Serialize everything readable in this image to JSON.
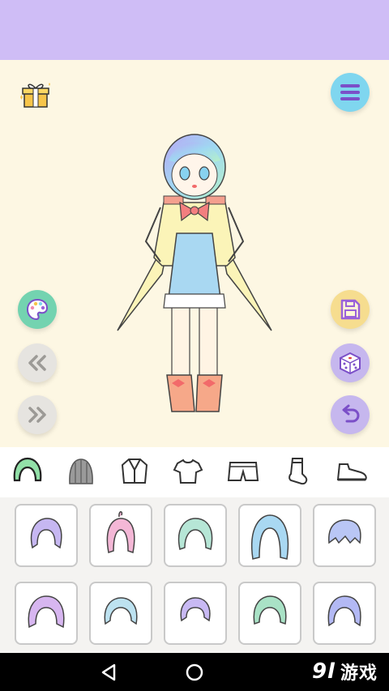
{
  "watermark": {
    "mark": "9l",
    "text": "游戏"
  },
  "colors": {
    "top_bar": "#cfbdf6",
    "stage_bg": "#fdf7e3",
    "menu_button": "#7fd6ef",
    "palette_button": "#73d3b0",
    "save_button": "#f6dd8f",
    "dice_button": "#c6b7ee",
    "undo_button": "#c6b7ee",
    "nav_arrow_buttons": "#e6e4e0"
  },
  "toolbar_left": [
    "gift-icon",
    "palette-icon",
    "previous-icon",
    "next-icon"
  ],
  "toolbar_right": [
    "menu-icon",
    "save-icon",
    "random-dice-icon",
    "undo-icon"
  ],
  "categories": [
    "hair",
    "hat",
    "jacket",
    "shirt",
    "shorts",
    "socks",
    "shoes"
  ],
  "selected_category": "hair",
  "hair_options_count": 10,
  "system_nav": [
    "back-icon",
    "home-icon"
  ]
}
